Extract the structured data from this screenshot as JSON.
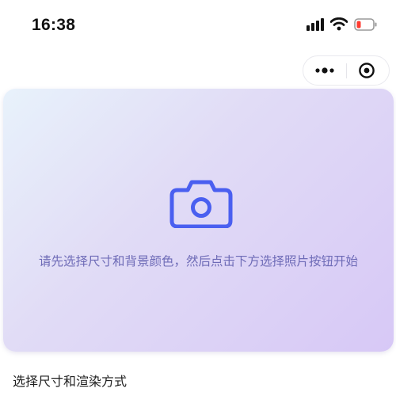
{
  "status_bar": {
    "time": "16:38",
    "icons": [
      "signal-icon",
      "wifi-icon",
      "battery-low-icon"
    ]
  },
  "capsule": {
    "icons": [
      "more-icon",
      "target-icon"
    ]
  },
  "preview": {
    "icon": "camera-icon",
    "hint": "请先选择尺寸和背景颜色，然后点击下方选择照片按钮开始"
  },
  "section": {
    "title": "选择尺寸和渲染方式"
  },
  "colors": {
    "accent": "#4a5ff0",
    "hint_text": "#6e6bb7",
    "battery_low": "#ff3b30"
  }
}
